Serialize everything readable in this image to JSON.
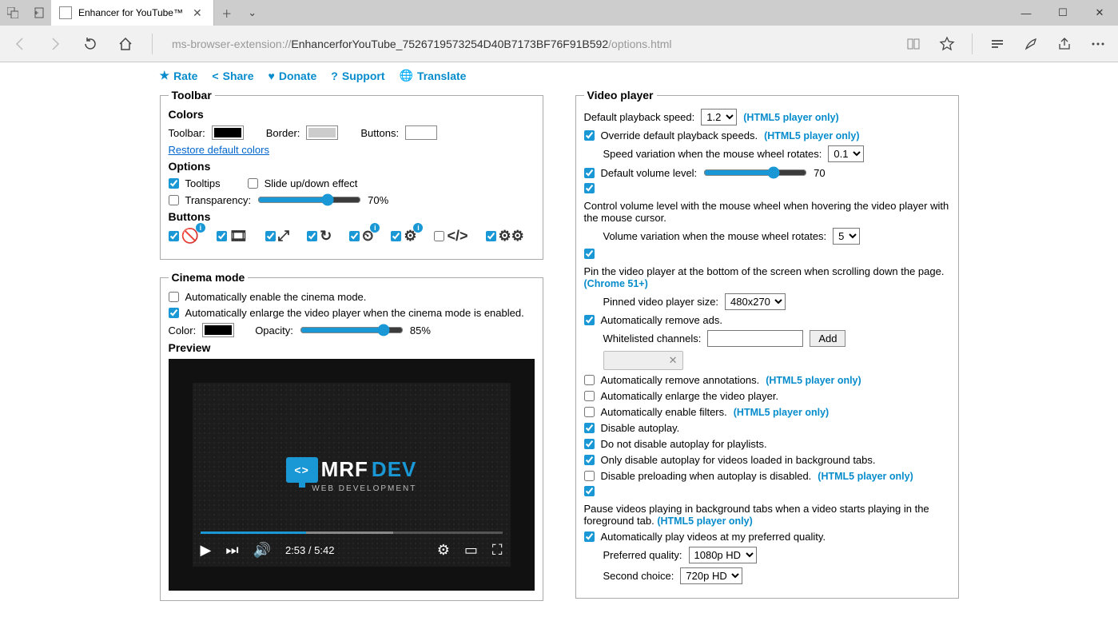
{
  "tab": {
    "title": "Enhancer for YouTube™"
  },
  "url": {
    "prefix": "ms-browser-extension://",
    "mid": "EnhancerforYouTube_7526719573254D40B7173BF76F91B592",
    "suffix": "/options.html"
  },
  "topnav": {
    "rate": "Rate",
    "share": "Share",
    "donate": "Donate",
    "support": "Support",
    "translate": "Translate"
  },
  "toolbar": {
    "legend": "Toolbar",
    "colors_h": "Colors",
    "toolbar_lbl": "Toolbar:",
    "border_lbl": "Border:",
    "buttons_lbl": "Buttons:",
    "toolbar_color": "#000000",
    "border_color": "#cccccc",
    "buttons_color": "#ffffff",
    "restore": "Restore default colors",
    "options_h": "Options",
    "tooltips": "Tooltips",
    "slide": "Slide up/down effect",
    "transparency": "Transparency:",
    "transparency_val": "70%",
    "buttons_h": "Buttons"
  },
  "cinema": {
    "legend": "Cinema mode",
    "auto_enable": "Automatically enable the cinema mode.",
    "auto_enlarge": "Automatically enlarge the video player when the cinema mode is enabled.",
    "color_lbl": "Color:",
    "color": "#000000",
    "opacity_lbl": "Opacity:",
    "opacity_val": "85%",
    "preview_h": "Preview",
    "logo_mrf": "MRF",
    "logo_dev": "DEV",
    "logo_sub": "WEB DEVELOPMENT",
    "logo_code": "<>",
    "time_cur": "2:53",
    "time_sep": " / ",
    "time_total": "5:42"
  },
  "player": {
    "legend": "Video player",
    "speed_lbl": "Default playback speed:",
    "speed_val": "1.2",
    "html5_only": "(HTML5 player only)",
    "override": "Override default playback speeds.",
    "speed_var_lbl": "Speed variation when the mouse wheel rotates:",
    "speed_var": "0.1",
    "volume_lbl": "Default volume level:",
    "volume_val": "70",
    "ctrl_volume": "Control volume level with the mouse wheel when hovering the video player with the mouse cursor.",
    "vol_var_lbl": "Volume variation when the mouse wheel rotates:",
    "vol_var": "5",
    "pin": "Pin the video player at the bottom of the screen when scrolling down the page.",
    "chrome51": "(Chrome 51+)",
    "pin_size_lbl": "Pinned video player size:",
    "pin_size": "480x270",
    "remove_ads": "Automatically remove ads.",
    "whitelist_lbl": "Whitelisted channels:",
    "add_btn": "Add",
    "remove_annotations": "Automatically remove annotations.",
    "auto_enlarge_p": "Automatically enlarge the video player.",
    "auto_filters": "Automatically enable filters.",
    "disable_autoplay": "Disable autoplay.",
    "no_disable_playlists": "Do not disable autoplay for playlists.",
    "only_bg": "Only disable autoplay for videos loaded in background tabs.",
    "disable_preload": "Disable preloading when autoplay is disabled.",
    "pause_bg": "Pause videos playing in background tabs when a video starts playing in the foreground tab.",
    "auto_quality": "Automatically play videos at my preferred quality.",
    "pref_quality_lbl": "Preferred quality:",
    "pref_quality": "1080p HD",
    "second_lbl": "Second choice:",
    "second": "720p HD"
  }
}
